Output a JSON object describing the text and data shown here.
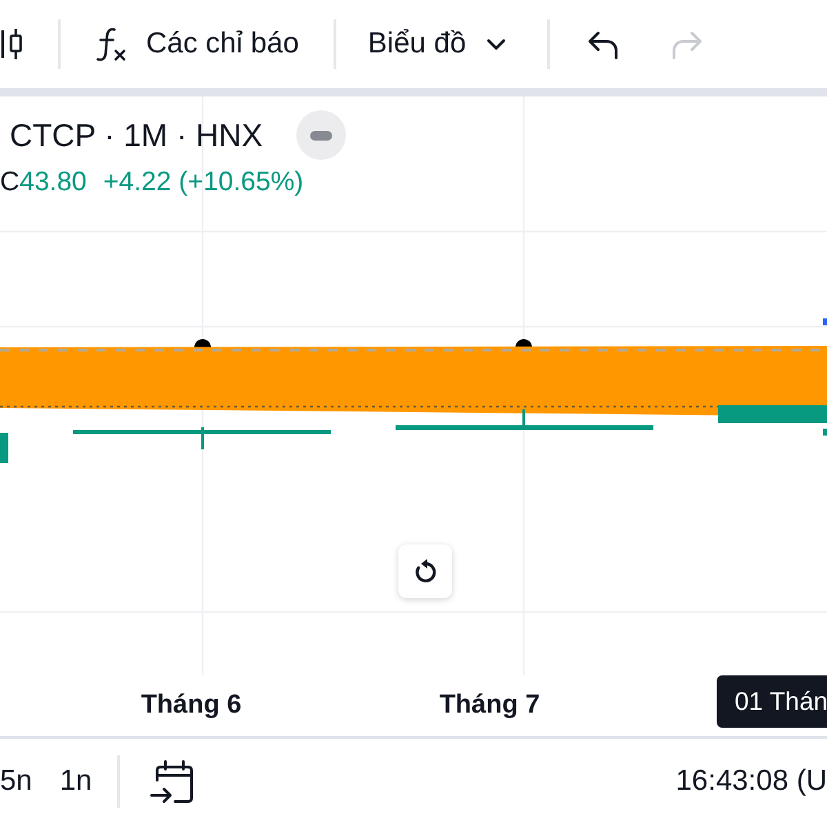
{
  "toolbar": {
    "indicators_button": {
      "label": "Các chỉ báo"
    },
    "chart_type_menu": {
      "label": "Biểu đồ"
    },
    "undo_button": {
      "disabled": false
    },
    "redo_button": {
      "disabled": true
    }
  },
  "legend": {
    "title": "CTCP · 1M · HNX",
    "close_label": "C",
    "close_value": "43.80",
    "change": "+4.22 (+10.65%)"
  },
  "time_axis": {
    "labels": [
      "Tháng 6",
      "Tháng 7"
    ],
    "cursor_label": "01 Thán"
  },
  "bottom_bar": {
    "intervals": [
      {
        "label": "5n",
        "selected": false
      },
      {
        "label": "1n",
        "selected": false
      }
    ],
    "clock": "16:43:08 (U"
  }
}
